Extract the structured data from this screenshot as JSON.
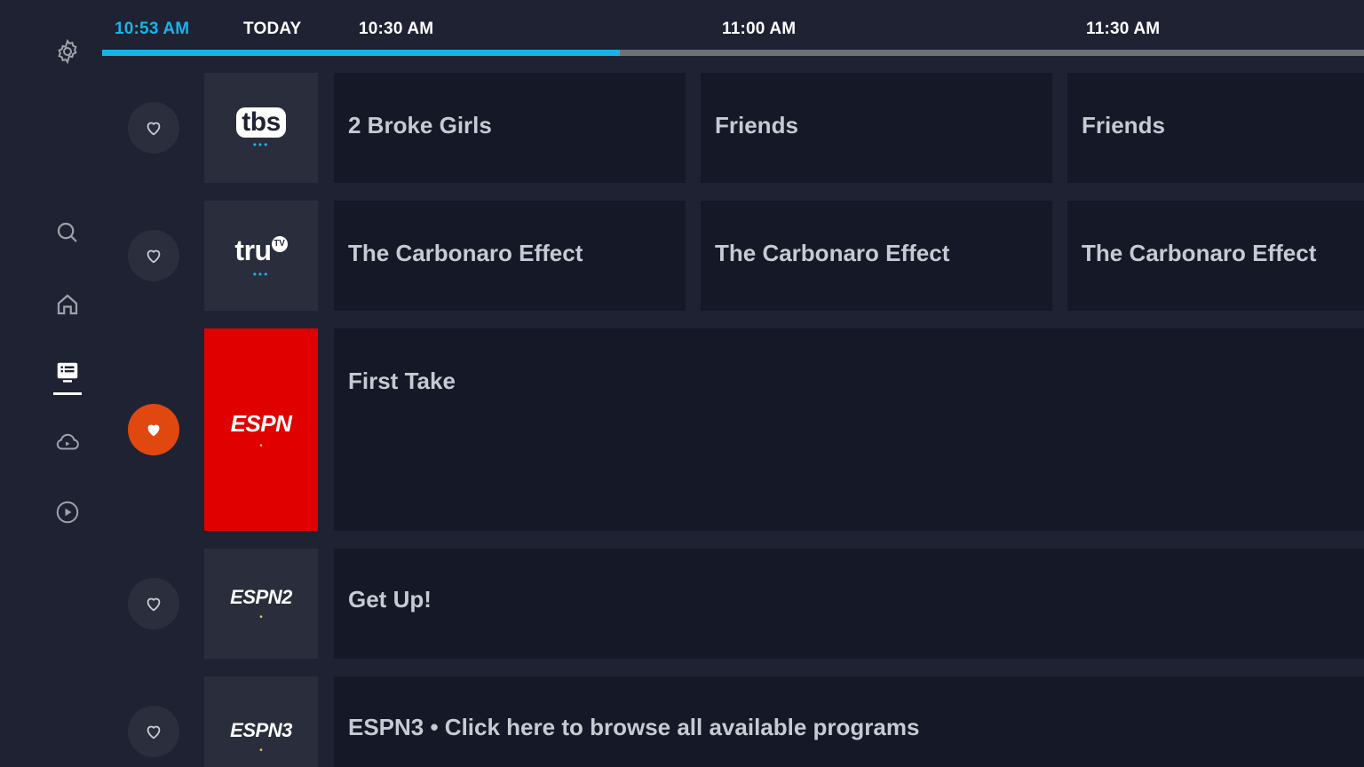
{
  "header": {
    "current_time": "10:53 AM",
    "day": "TODAY",
    "slots": [
      "10:30 AM",
      "11:00 AM",
      "11:30 AM"
    ],
    "progress_fraction": 0.41
  },
  "sidebar": {
    "items": [
      {
        "name": "settings",
        "icon": "gear-icon"
      },
      {
        "name": "search",
        "icon": "search-icon"
      },
      {
        "name": "home",
        "icon": "home-icon"
      },
      {
        "name": "guide",
        "icon": "guide-list-icon",
        "selected": true
      },
      {
        "name": "cloud-dvr",
        "icon": "cloud-play-icon"
      },
      {
        "name": "on-demand",
        "icon": "play-circle-icon"
      }
    ]
  },
  "channels": [
    {
      "logo": "tbs",
      "favorite": false,
      "programs": [
        "2 Broke Girls",
        "Friends",
        "Friends"
      ]
    },
    {
      "logo": "tru",
      "logo_badge": "TV",
      "favorite": false,
      "programs": [
        "The Carbonaro Effect",
        "The Carbonaro Effect",
        "The Carbonaro Effect"
      ]
    },
    {
      "logo": "ESPN",
      "favorite": true,
      "focused": true,
      "programs": [
        "First Take"
      ]
    },
    {
      "logo": "ESPN2",
      "favorite": false,
      "programs": [
        "Get Up!"
      ]
    },
    {
      "logo": "ESPN3",
      "favorite": false,
      "programs": [
        "ESPN3 • Click here to browse all available programs"
      ]
    }
  ],
  "colors": {
    "accent": "#17b4e9",
    "favorite_active": "#e0480f",
    "focused_logo": "#e00000"
  }
}
